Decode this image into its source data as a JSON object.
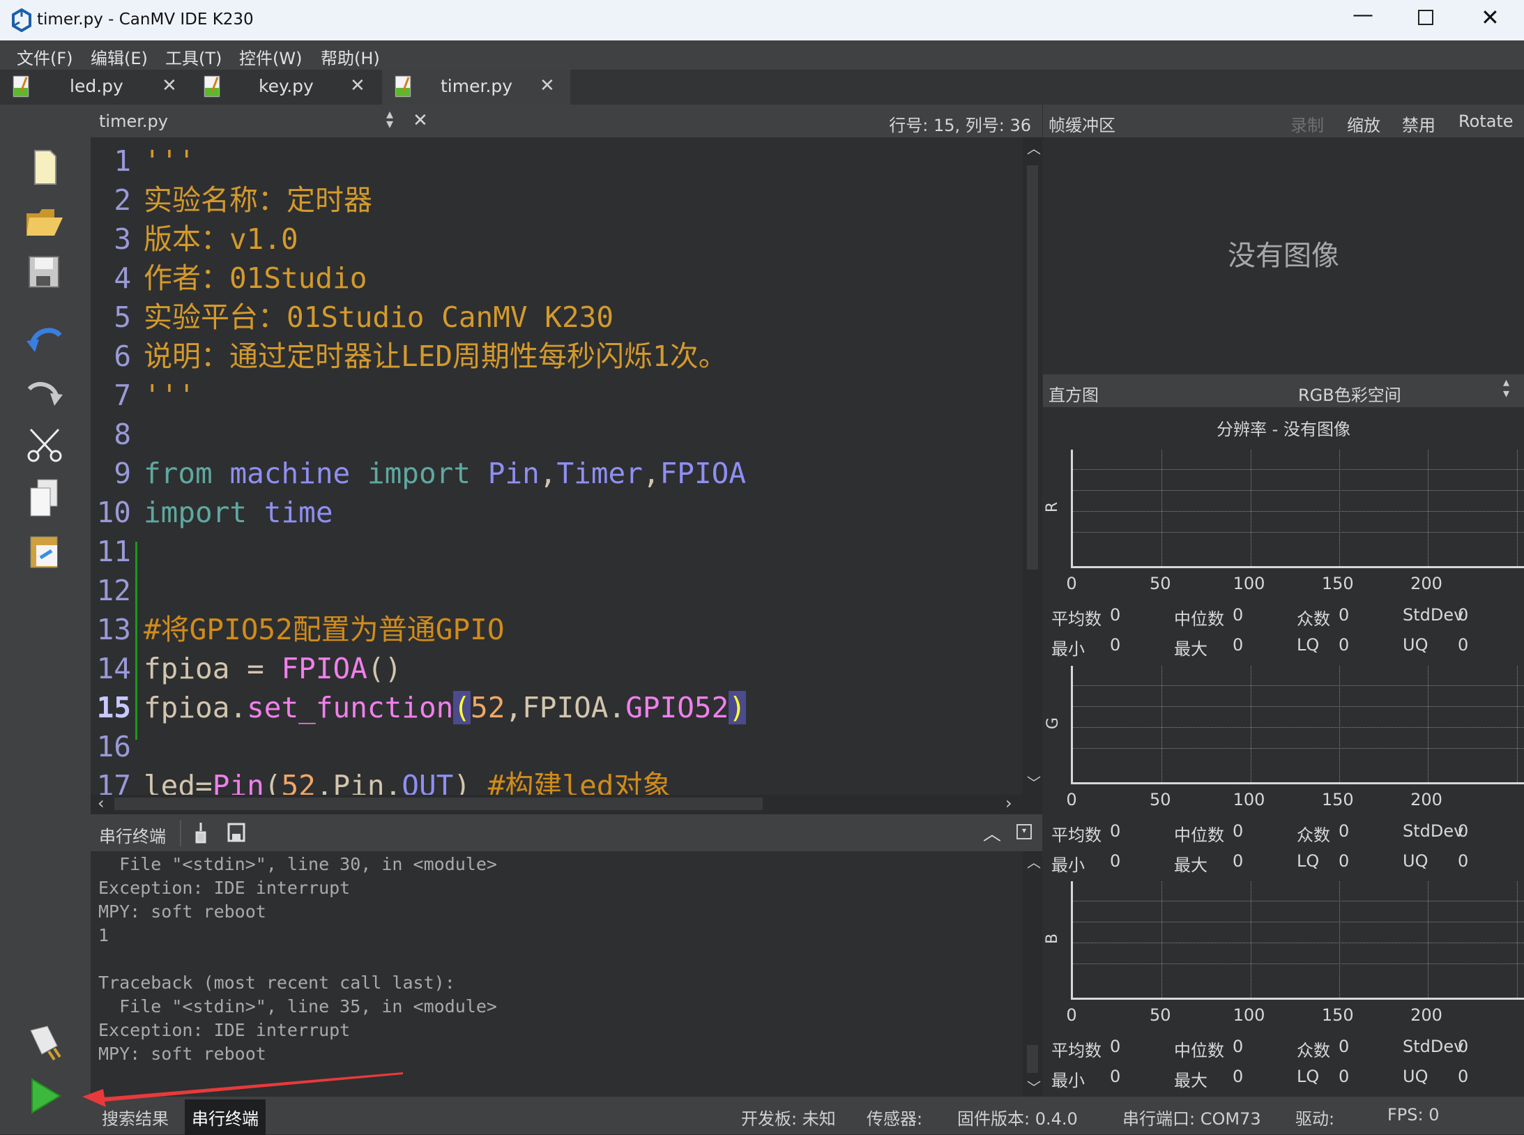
{
  "window": {
    "title": "timer.py - CanMV IDE K230",
    "controls": [
      "minimize",
      "maximize",
      "close"
    ]
  },
  "menu": [
    "文件(F)",
    "编辑(E)",
    "工具(T)",
    "控件(W)",
    "帮助(H)"
  ],
  "tabs": [
    {
      "label": "led.py",
      "active": false
    },
    {
      "label": "key.py",
      "active": false
    },
    {
      "label": "timer.py",
      "active": true
    }
  ],
  "toolbar": {
    "icons": [
      "new-file-icon",
      "open-folder-icon",
      "save-icon",
      "undo-icon",
      "redo-icon",
      "cut-icon",
      "copy-icon",
      "paste-icon",
      "connect-icon",
      "run-icon"
    ]
  },
  "editor": {
    "file": "timer.py",
    "position": "行号: 15, 列号: 36",
    "current_line": 15,
    "lines": [
      [
        [
          "'''",
          "doc"
        ]
      ],
      [
        [
          "实验名称：定时器",
          "doc"
        ]
      ],
      [
        [
          "版本：v1.0",
          "doc"
        ]
      ],
      [
        [
          "作者：01Studio",
          "doc"
        ]
      ],
      [
        [
          "实验平台：01Studio CanMV K230",
          "doc"
        ]
      ],
      [
        [
          "说明：通过定时器让LED周期性每秒闪烁1次。",
          "doc"
        ]
      ],
      [
        [
          "'''",
          "doc"
        ]
      ],
      [],
      [
        [
          "from",
          "kw"
        ],
        [
          " ",
          "df"
        ],
        [
          "machine",
          "nm"
        ],
        [
          " ",
          "df"
        ],
        [
          "import",
          "kw"
        ],
        [
          " ",
          "df"
        ],
        [
          "Pin",
          "nm"
        ],
        [
          ",",
          "df"
        ],
        [
          "Timer",
          "nm"
        ],
        [
          ",",
          "df"
        ],
        [
          "FPIOA",
          "nm"
        ]
      ],
      [
        [
          "import",
          "kw"
        ],
        [
          " ",
          "df"
        ],
        [
          "time",
          "nm"
        ]
      ],
      [],
      [],
      [
        [
          "#将GPIO52配置为普通GPIO",
          "cm"
        ]
      ],
      [
        [
          "fpioa = ",
          "df"
        ],
        [
          "FPIOA",
          "fn"
        ],
        [
          "()",
          "df"
        ]
      ],
      [
        [
          "fpioa.",
          "df"
        ],
        [
          "set_function",
          "fn"
        ],
        [
          "(",
          "br"
        ],
        [
          "52",
          "num"
        ],
        [
          ",FPIOA.",
          "df"
        ],
        [
          "GPIO52",
          "fn"
        ],
        [
          ")",
          "br"
        ]
      ],
      [],
      [
        [
          "led=",
          "df"
        ],
        [
          "Pin",
          "fn"
        ],
        [
          "(",
          "df"
        ],
        [
          "52",
          "num"
        ],
        [
          ",Pin.",
          "df"
        ],
        [
          "OUT",
          "nm"
        ],
        [
          ") ",
          "df"
        ],
        [
          "#构建led对象",
          "cm"
        ]
      ]
    ]
  },
  "terminal": {
    "title": "串行终端",
    "lines": [
      "  File \"<stdin>\", line 30, in <module>",
      "Exception: IDE interrupt",
      "MPY: soft reboot",
      "1",
      "",
      "Traceback (most recent call last):",
      "  File \"<stdin>\", line 35, in <module>",
      "Exception: IDE interrupt",
      "MPY: soft reboot"
    ]
  },
  "bottom_tabs": [
    {
      "label": "搜索结果",
      "active": false
    },
    {
      "label": "串行终端",
      "active": true
    }
  ],
  "status": {
    "board": "开发板: 未知",
    "sensor": "传感器:",
    "firmware": "固件版本: 0.4.0",
    "port": "串行端口: COM73",
    "driver": "驱动:",
    "fps": "FPS: 0"
  },
  "framebuffer": {
    "title": "帧缓冲区",
    "record": "录制",
    "zoom": "缩放",
    "disable": "禁用",
    "rotate": "Rotate",
    "no_image": "没有图像"
  },
  "histogram": {
    "title": "直方图",
    "colorspace": "RGB色彩空间",
    "resolution": "分辨率 - 没有图像",
    "ticks": [
      "0",
      "50",
      "100",
      "150",
      "200"
    ],
    "channels": [
      {
        "name": "R",
        "stats": [
          [
            "平均数",
            "0"
          ],
          [
            "中位数",
            "0"
          ],
          [
            "众数",
            "0"
          ],
          [
            "StdDev",
            "0"
          ],
          [
            "最小",
            "0"
          ],
          [
            "最大",
            "0"
          ],
          [
            "LQ",
            "0"
          ],
          [
            "UQ",
            "0"
          ]
        ]
      },
      {
        "name": "G",
        "stats": [
          [
            "平均数",
            "0"
          ],
          [
            "中位数",
            "0"
          ],
          [
            "众数",
            "0"
          ],
          [
            "StdDev",
            "0"
          ],
          [
            "最小",
            "0"
          ],
          [
            "最大",
            "0"
          ],
          [
            "LQ",
            "0"
          ],
          [
            "UQ",
            "0"
          ]
        ]
      },
      {
        "name": "B",
        "stats": [
          [
            "平均数",
            "0"
          ],
          [
            "中位数",
            "0"
          ],
          [
            "众数",
            "0"
          ],
          [
            "StdDev",
            "0"
          ],
          [
            "最小",
            "0"
          ],
          [
            "最大",
            "0"
          ],
          [
            "LQ",
            "0"
          ],
          [
            "UQ",
            "0"
          ]
        ]
      }
    ]
  },
  "colors": {
    "accent_run": "#3cb83c",
    "annotation_arrow": "#e83a3a",
    "editor_bg": "#2e2f31",
    "panel_bg": "#404142"
  }
}
